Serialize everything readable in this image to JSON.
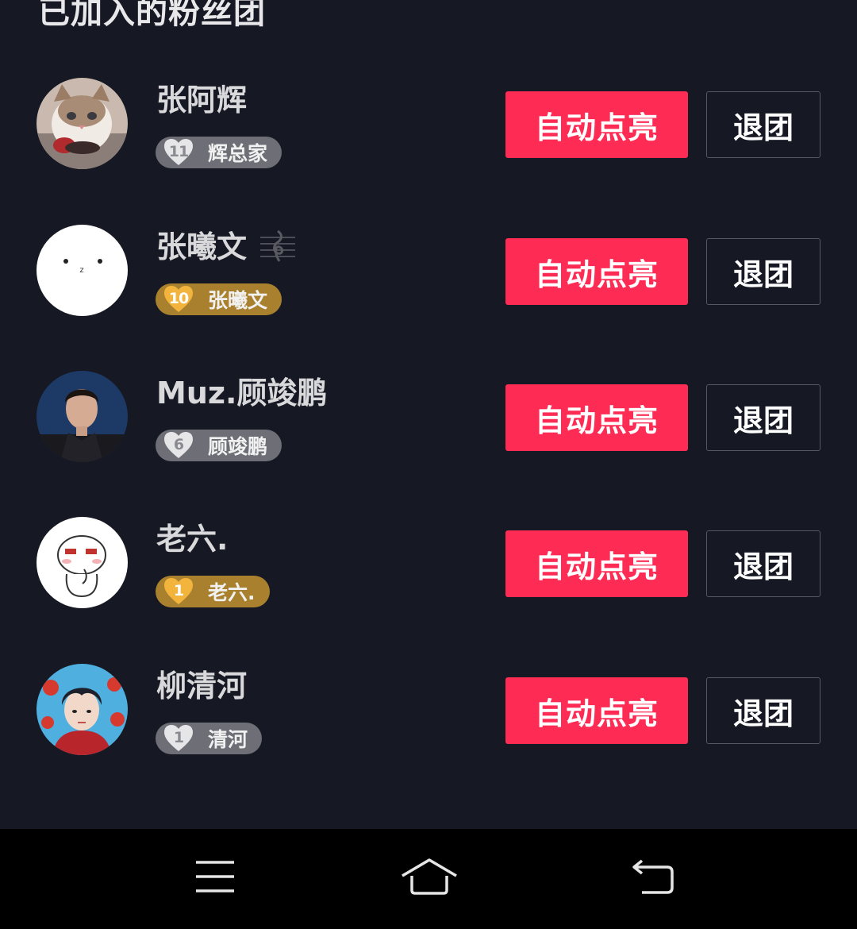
{
  "page": {
    "title": "已加入的粉丝团"
  },
  "colors": {
    "background": "#161823",
    "accent": "#fe2c55",
    "badge_gray": "#6e6f76",
    "badge_gold": "#a9812e",
    "navbar": "#000000"
  },
  "buttons": {
    "auto_light_label": "自动点亮",
    "quit_label": "退团"
  },
  "fan_clubs": [
    {
      "name": "张阿辉",
      "badge_level": "11",
      "badge_name": "辉总家",
      "badge_style": "gray",
      "avatar_icon": "cat-avatar",
      "extra_icon": ""
    },
    {
      "name": "张曦文",
      "badge_level": "10",
      "badge_name": "张曦文",
      "badge_style": "gold",
      "avatar_icon": "white-face-avatar",
      "extra_icon": "music-note-icon"
    },
    {
      "name": "Muz.顾竣鹏",
      "badge_level": "6",
      "badge_name": "顾竣鹏",
      "badge_style": "gray",
      "avatar_icon": "man-portrait-avatar",
      "extra_icon": ""
    },
    {
      "name": "老六.",
      "badge_level": "1",
      "badge_name": "老六.",
      "badge_style": "gold",
      "avatar_icon": "cartoon-bunny-avatar",
      "extra_icon": ""
    },
    {
      "name": "柳清河",
      "badge_level": "1",
      "badge_name": "清河",
      "badge_style": "gray",
      "avatar_icon": "anime-boy-avatar",
      "extra_icon": ""
    }
  ],
  "navbar": {
    "items": [
      "menu-icon",
      "home-icon",
      "back-icon"
    ]
  }
}
